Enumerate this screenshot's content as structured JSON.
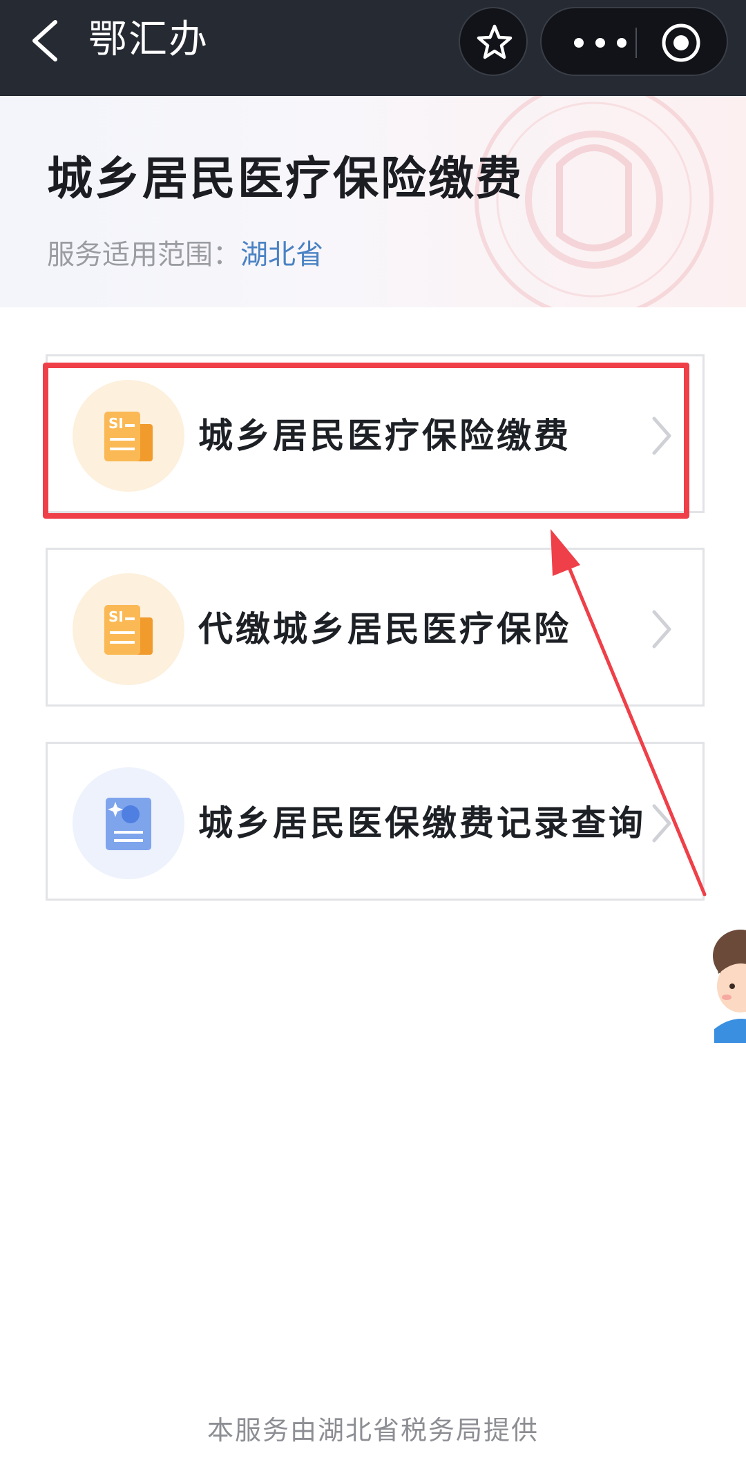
{
  "navbar": {
    "back_icon": "chevron-left-icon",
    "title": "鄂汇办",
    "favorite_icon": "star-icon",
    "more_icon": "more-dots-icon",
    "close_icon": "target-circle-icon"
  },
  "header": {
    "title": "城乡居民医疗保险缴费",
    "scope_label": "服务适用范围：",
    "scope_value": "湖北省"
  },
  "services": [
    {
      "label": "城乡居民医疗保险缴费",
      "icon": "si-document-icon",
      "highlighted": true
    },
    {
      "label": "代缴城乡居民医疗保险",
      "icon": "si-document-icon",
      "highlighted": false
    },
    {
      "label": "城乡居民医保缴费记录查询",
      "icon": "record-query-icon",
      "highlighted": false
    }
  ],
  "colors": {
    "navbar_bg": "#262a33",
    "accent_blue": "#4a82c4",
    "annotation_red": "#ef3f48",
    "orange_icon": "#f5a623"
  },
  "footer": {
    "text": "本服务由湖北省税务局提供"
  }
}
